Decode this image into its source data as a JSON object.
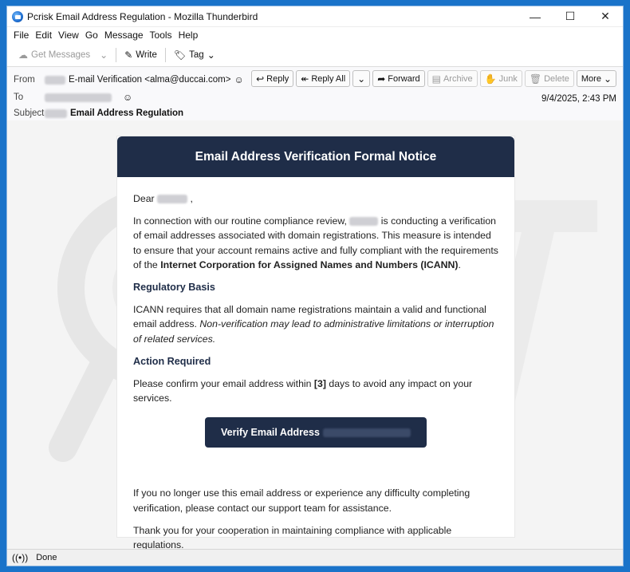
{
  "window": {
    "title": "Pcrisk Email Address Regulation - Mozilla Thunderbird",
    "minimize_glyph": "—",
    "maximize_glyph": "☐",
    "close_glyph": "✕"
  },
  "menubar": {
    "items": [
      "File",
      "Edit",
      "View",
      "Go",
      "Message",
      "Tools",
      "Help"
    ]
  },
  "toolbar": {
    "get_messages": "Get Messages",
    "write": "Write",
    "tag": "Tag"
  },
  "header": {
    "from_label": "From",
    "from_value": "E-mail Verification <alma@duccai.com>",
    "to_label": "To",
    "subject_label": "Subject",
    "subject_value": "Email Address Regulation",
    "date": "9/4/2025, 2:43 PM",
    "actions": {
      "reply": "Reply",
      "reply_all": "Reply All",
      "forward": "Forward",
      "archive": "Archive",
      "junk": "Junk",
      "delete": "Delete",
      "more": "More"
    }
  },
  "email": {
    "heading": "Email Address Verification Formal Notice",
    "greeting": "Dear",
    "greeting_end": ",",
    "p1_a": "In connection with our routine compliance review,",
    "p1_b": "is conducting a verification of email addresses associated with domain registrations. This measure is intended to ensure that your account remains active and fully compliant with the requirements of the",
    "p1_bold": "Internet Corporation for Assigned Names and Numbers (ICANN)",
    "p1_end": ".",
    "section1": "Regulatory Basis",
    "p2_a": "ICANN requires that all domain name registrations maintain a valid and functional email address.",
    "p2_italic": "Non-verification may lead to administrative limitations or interruption of related services.",
    "section2": "Action Required",
    "p3_a": "Please confirm your email address within",
    "p3_bold": "[3]",
    "p3_b": "days to avoid any impact on your services.",
    "cta": "Verify Email Address",
    "p4": "If you no longer use this email address or experience any difficulty completing verification, please contact our support team for assistance.",
    "p5": "Thank you for your cooperation in maintaining compliance with applicable regulations."
  },
  "status": {
    "text": "Done"
  }
}
